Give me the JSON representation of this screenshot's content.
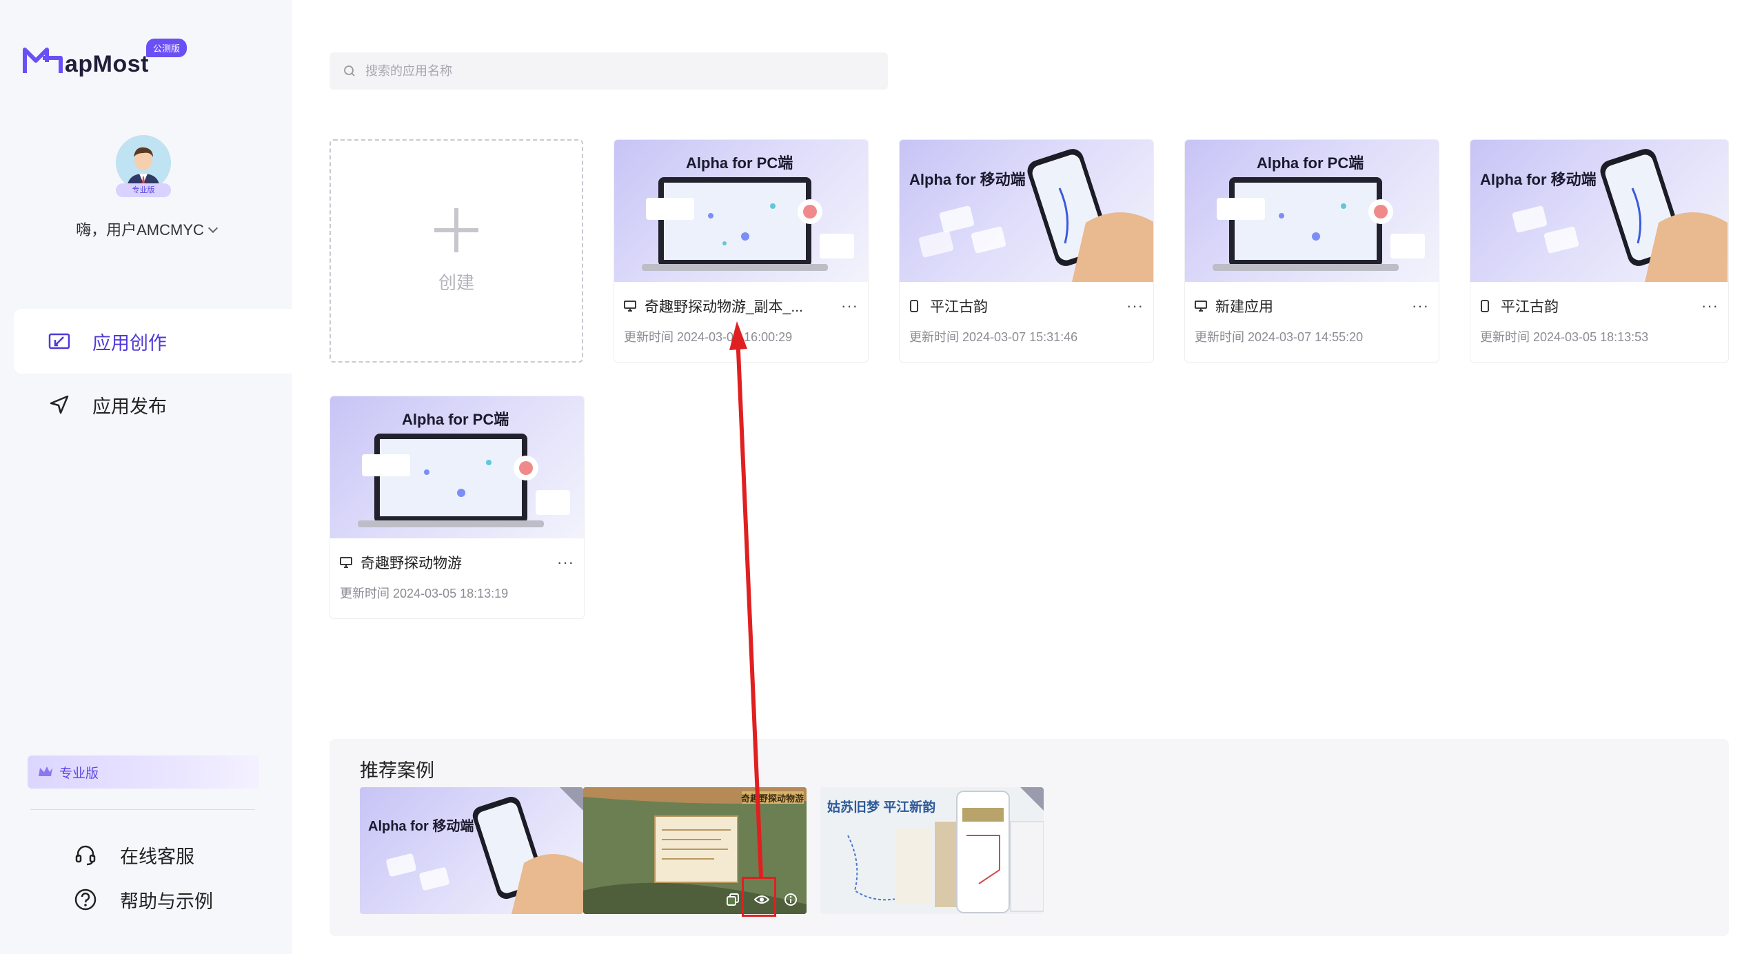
{
  "brand": {
    "logo_text": "apMost",
    "beta": "公测版"
  },
  "user": {
    "greeting": "嗨，用户AMCMYC",
    "badge": "专业版"
  },
  "sidebar": {
    "nav": [
      {
        "label": "应用创作",
        "active": true
      },
      {
        "label": "应用发布",
        "active": false
      }
    ],
    "pro_banner": "专业版",
    "help": [
      {
        "label": "在线客服"
      },
      {
        "label": "帮助与示例"
      }
    ]
  },
  "search": {
    "placeholder": "搜索的应用名称"
  },
  "create": {
    "label": "创建"
  },
  "apps": [
    {
      "thumb_title": "Alpha for PC端",
      "device": "pc",
      "name": "奇趣野探动物游_副本_...",
      "time": "更新时间 2024-03-07 16:00:29"
    },
    {
      "thumb_title": "Alpha for 移动端",
      "device": "mobile",
      "name": "平江古韵",
      "time": "更新时间 2024-03-07 15:31:46"
    },
    {
      "thumb_title": "Alpha for PC端",
      "device": "pc",
      "name": "新建应用",
      "time": "更新时间 2024-03-07 14:55:20"
    },
    {
      "thumb_title": "Alpha for 移动端",
      "device": "mobile",
      "name": "平江古韵",
      "time": "更新时间 2024-03-05 18:13:53"
    },
    {
      "thumb_title": "Alpha for PC端",
      "device": "pc",
      "name": "奇趣野探动物游",
      "time": "更新时间 2024-03-05 18:13:19"
    }
  ],
  "recommend": {
    "title": "推荐案例",
    "cases": [
      {
        "text": "Alpha for 移动端"
      },
      {
        "text": "奇趣野探动物游"
      },
      {
        "text": "姑苏旧梦 平江新韵"
      }
    ]
  },
  "colors": {
    "accent": "#4d3ad8",
    "annotation": "#e02020"
  }
}
